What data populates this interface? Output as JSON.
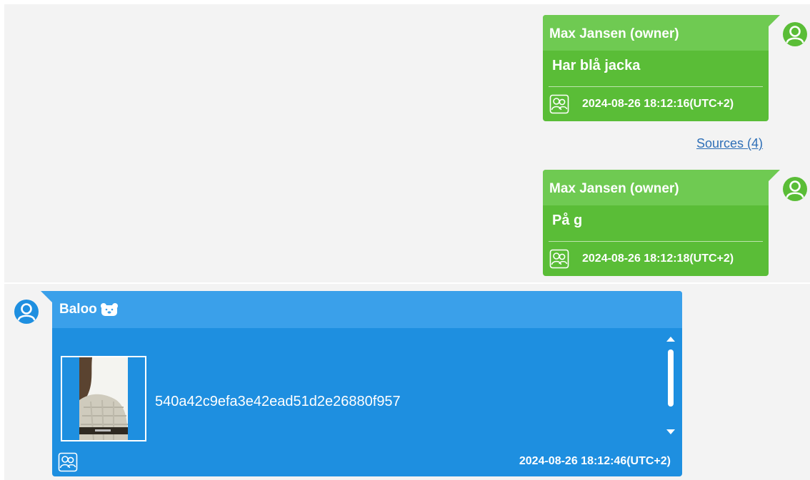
{
  "messages_outgoing": [
    {
      "sender": "Max Jansen (owner)",
      "text": "Har blå jacka",
      "timestamp": "2024-08-26 18:12:16(UTC+2)"
    },
    {
      "sender": "Max Jansen (owner)",
      "text": "På g",
      "timestamp": "2024-08-26 18:12:18(UTC+2)"
    }
  ],
  "sources_link": "Sources (4)",
  "message_incoming": {
    "sender": "Baloo",
    "sender_emoji_icon": "bear-face-icon",
    "attachment_name": "540a42c9efa3e42ead51d2e26880f957",
    "timestamp": "2024-08-26 18:12:46(UTC+2)"
  },
  "icons": {
    "avatar": "user-avatar-icon",
    "group": "participants-icon",
    "scroll_up": "chevron-up-icon",
    "scroll_down": "chevron-down-icon"
  },
  "colors": {
    "outgoing_bubble": "#5abd37",
    "outgoing_header": "#6fca52",
    "incoming_bubble": "#1e8fe0",
    "incoming_header": "#3aa0ea",
    "link": "#2f6fb7",
    "background": "#f3f3f3"
  }
}
